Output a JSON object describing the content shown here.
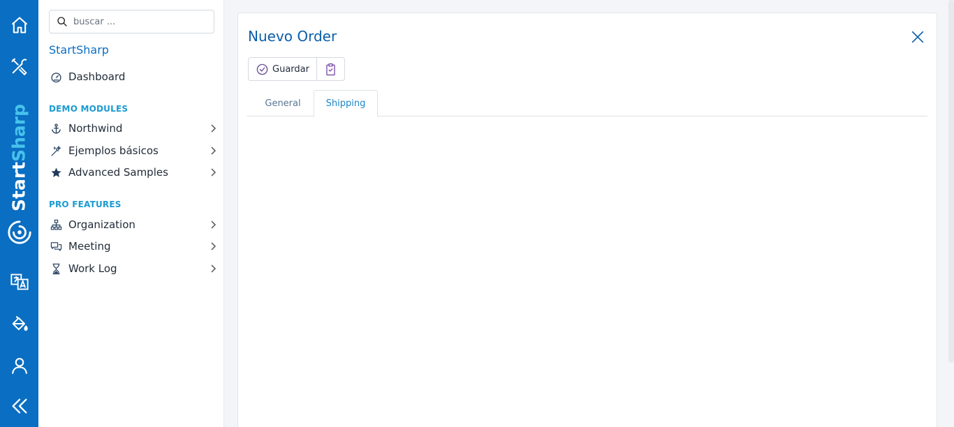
{
  "brand": {
    "start": "Start",
    "sharp": "Sharp"
  },
  "rail": {
    "items": [
      {
        "icon": "home-icon"
      },
      {
        "icon": "tools-icon"
      },
      {
        "icon": "translate-icon"
      },
      {
        "icon": "paint-bucket-icon"
      },
      {
        "icon": "user-icon"
      },
      {
        "icon": "collapse-icon"
      }
    ]
  },
  "sidebar": {
    "search_placeholder": "buscar ...",
    "title": "StartSharp",
    "dashboard": "Dashboard",
    "section_demo": "DEMO MODULES",
    "demo_items": [
      {
        "label": "Northwind",
        "icon": "anchor-icon"
      },
      {
        "label": "Ejemplos básicos",
        "icon": "magic-wand-icon"
      },
      {
        "label": "Advanced Samples",
        "icon": "star-icon"
      }
    ],
    "section_pro": "PRO FEATURES",
    "pro_items": [
      {
        "label": "Organization",
        "icon": "org-chart-icon"
      },
      {
        "label": "Meeting",
        "icon": "chat-icon"
      },
      {
        "label": "Work Log",
        "icon": "hourglass-icon"
      }
    ]
  },
  "dialog": {
    "title": "Nuevo Order",
    "save_label": "Guardar",
    "tabs": [
      {
        "label": "General",
        "active": false
      },
      {
        "label": "Shipping",
        "active": true
      }
    ]
  },
  "colors": {
    "rail": "#0a6ec2",
    "accent": "#1a9bd0",
    "title": "#0a5ea8"
  }
}
